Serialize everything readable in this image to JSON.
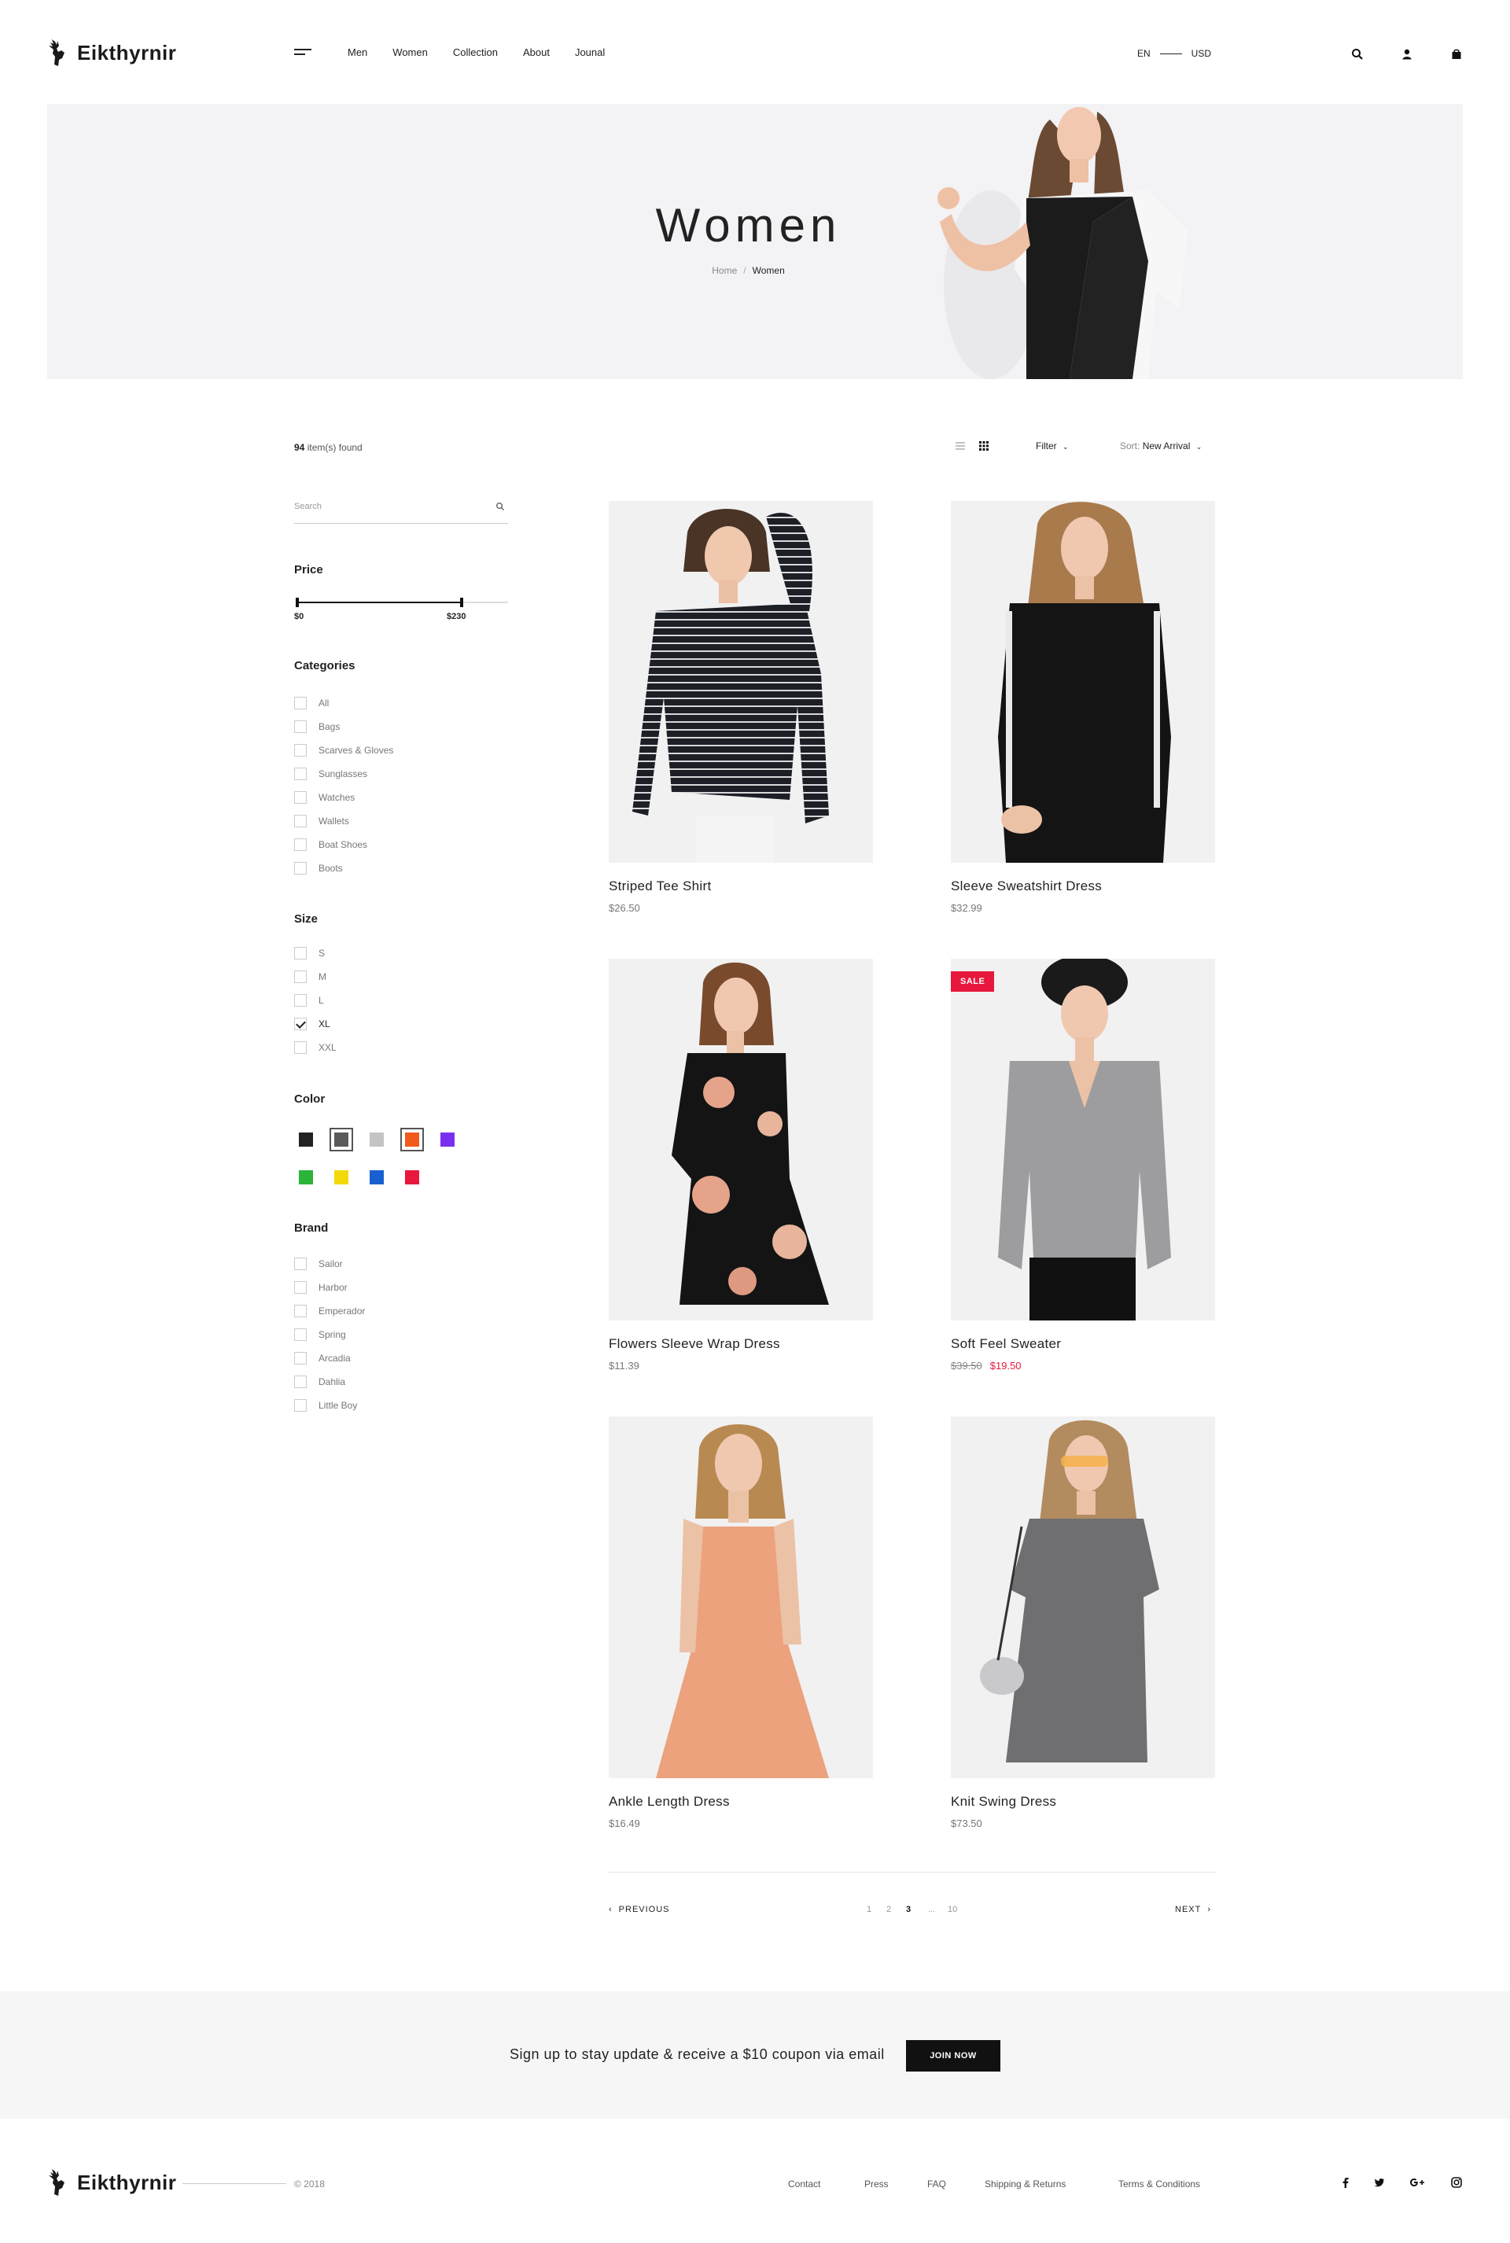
{
  "brand": {
    "name": "Eikthyrnir"
  },
  "nav": {
    "items": [
      {
        "label": "Men"
      },
      {
        "label": "Women"
      },
      {
        "label": "Collection"
      },
      {
        "label": "About"
      },
      {
        "label": "Jounal"
      }
    ]
  },
  "locale": {
    "language": "EN",
    "currency": "USD"
  },
  "header_icons": [
    "search-icon",
    "user-icon",
    "cart-icon"
  ],
  "hero": {
    "title": "Women",
    "breadcrumb": {
      "home": "Home",
      "separator": "/",
      "current": "Women"
    }
  },
  "listing": {
    "count": "94",
    "count_suffix": " item(s) found",
    "filter_label": "Filter",
    "sort_label": "Sort:",
    "sort_value": "New Arrival"
  },
  "sidebar": {
    "search_placeholder": "Search",
    "price": {
      "heading": "Price",
      "min_label": "$0",
      "max_label": "$230",
      "selected_fraction": 0.78
    },
    "categories": {
      "heading": "Categories",
      "items": [
        {
          "label": "All"
        },
        {
          "label": "Bags"
        },
        {
          "label": "Scarves & Gloves"
        },
        {
          "label": "Sunglasses"
        },
        {
          "label": "Watches"
        },
        {
          "label": "Wallets"
        },
        {
          "label": "Boat Shoes"
        },
        {
          "label": "Boots"
        }
      ]
    },
    "size": {
      "heading": "Size",
      "items": [
        {
          "label": "S",
          "checked": false
        },
        {
          "label": "M",
          "checked": false
        },
        {
          "label": "L",
          "checked": false
        },
        {
          "label": "XL",
          "checked": true
        },
        {
          "label": "XXL",
          "checked": false
        }
      ]
    },
    "color": {
      "heading": "Color",
      "swatches": [
        {
          "hex": "#222222",
          "selected": false
        },
        {
          "hex": "#5a5a5a",
          "selected": true
        },
        {
          "hex": "#c4c4c4",
          "selected": false
        },
        {
          "hex": "#f05a1a",
          "selected": true
        },
        {
          "hex": "#7a2ff0",
          "selected": false
        },
        {
          "hex": "#2bb43a",
          "selected": false
        },
        {
          "hex": "#f2d90c",
          "selected": false
        },
        {
          "hex": "#1a5fd0",
          "selected": false
        },
        {
          "hex": "#e8173d",
          "selected": false
        }
      ]
    },
    "brand": {
      "heading": "Brand",
      "items": [
        {
          "label": "Sailor"
        },
        {
          "label": "Harbor"
        },
        {
          "label": "Emperador"
        },
        {
          "label": "Spring"
        },
        {
          "label": "Arcadia"
        },
        {
          "label": "Dahlia"
        },
        {
          "label": "Little Boy"
        }
      ]
    }
  },
  "products": [
    {
      "name": "Striped Tee Shirt",
      "price": "$26.50"
    },
    {
      "name": "Sleeve Sweatshirt Dress",
      "price": "$32.99"
    },
    {
      "name": "Flowers Sleeve Wrap Dress",
      "price": "$11.39"
    },
    {
      "name": "Soft Feel Sweater",
      "old_price": "$39.50",
      "price": "$19.50",
      "badge": "SALE"
    },
    {
      "name": "Ankle Length Dress",
      "price": "$16.49"
    },
    {
      "name": "Knit Swing Dress",
      "price": "$73.50"
    }
  ],
  "pagination": {
    "previous": "PREVIOUS",
    "next": "NEXT",
    "pages": [
      "1",
      "2",
      "3",
      "...",
      "10"
    ],
    "current": "3"
  },
  "newsletter": {
    "text": "Sign up to stay update & receive a $10 coupon via email",
    "button": "JOIN NOW"
  },
  "footer": {
    "copyright": "© 2018",
    "links": [
      {
        "label": "Contact"
      },
      {
        "label": "Press"
      },
      {
        "label": "FAQ"
      },
      {
        "label": "Shipping & Returns"
      },
      {
        "label": "Terms & Conditions"
      }
    ],
    "social": [
      "facebook-icon",
      "twitter-icon",
      "google-plus-icon",
      "instagram-icon"
    ]
  },
  "colors": {
    "sale": "#e8173d",
    "dark": "#111111",
    "hero_bg": "#f3f2f4"
  }
}
